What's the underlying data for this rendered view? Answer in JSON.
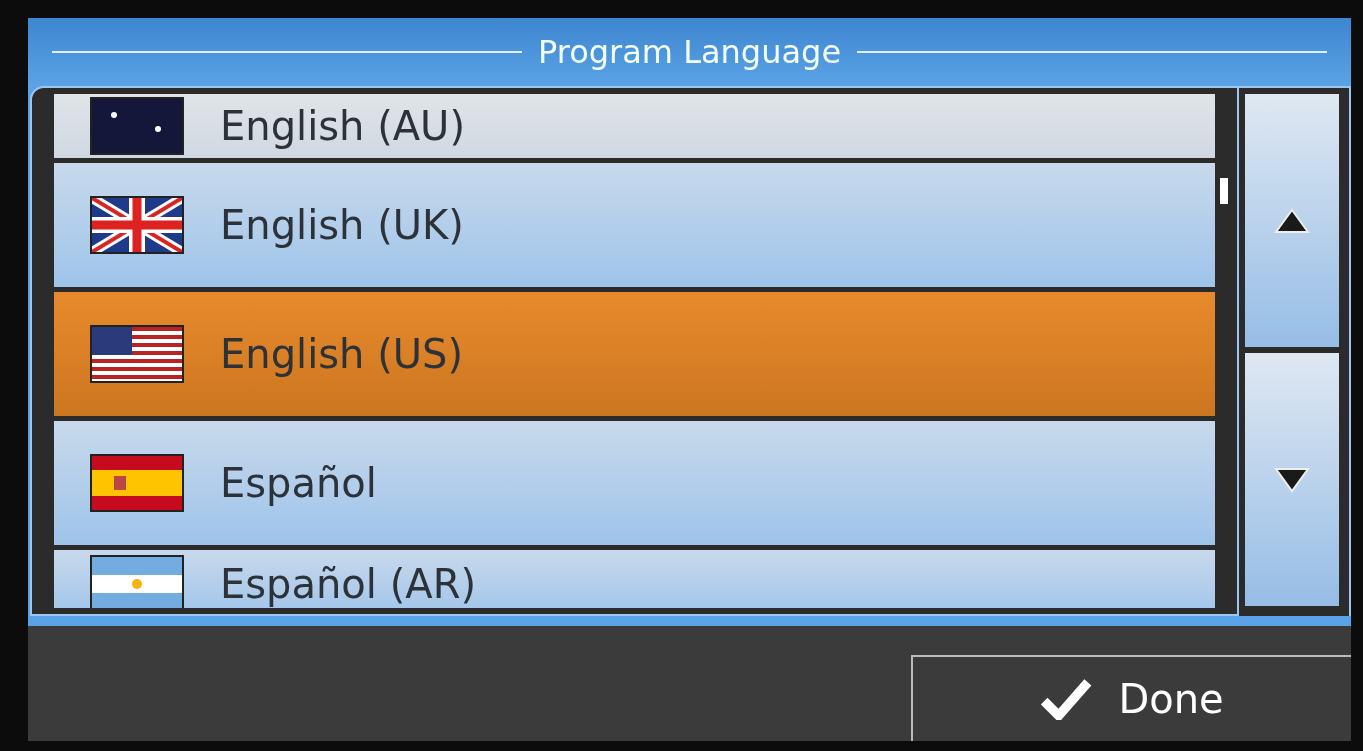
{
  "title": "Program Language",
  "languages": [
    {
      "label": "English (AU)",
      "kind": "au",
      "selected": false
    },
    {
      "label": "English (UK)",
      "kind": "uk",
      "selected": false
    },
    {
      "label": "English (US)",
      "kind": "us",
      "selected": true
    },
    {
      "label": "Español",
      "kind": "es",
      "selected": false
    },
    {
      "label": "Español (AR)",
      "kind": "ar",
      "selected": false
    }
  ],
  "done_button": {
    "label": "Done"
  }
}
